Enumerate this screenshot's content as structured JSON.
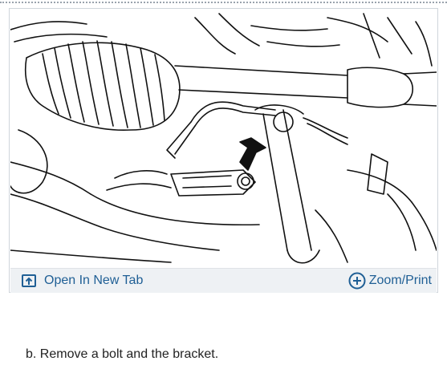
{
  "figure": {
    "toolbar": {
      "open_new_tab_label": "Open In New Tab",
      "zoom_print_label": "Zoom/Print",
      "open_icon": "open-in-new-tab-icon",
      "zoom_icon": "zoom-plus-icon"
    }
  },
  "caption": "b. Remove a bolt and the bracket.",
  "colors": {
    "link": "#1f5f95",
    "toolbar_bg": "#eef1f4",
    "border": "#cfd5db"
  }
}
